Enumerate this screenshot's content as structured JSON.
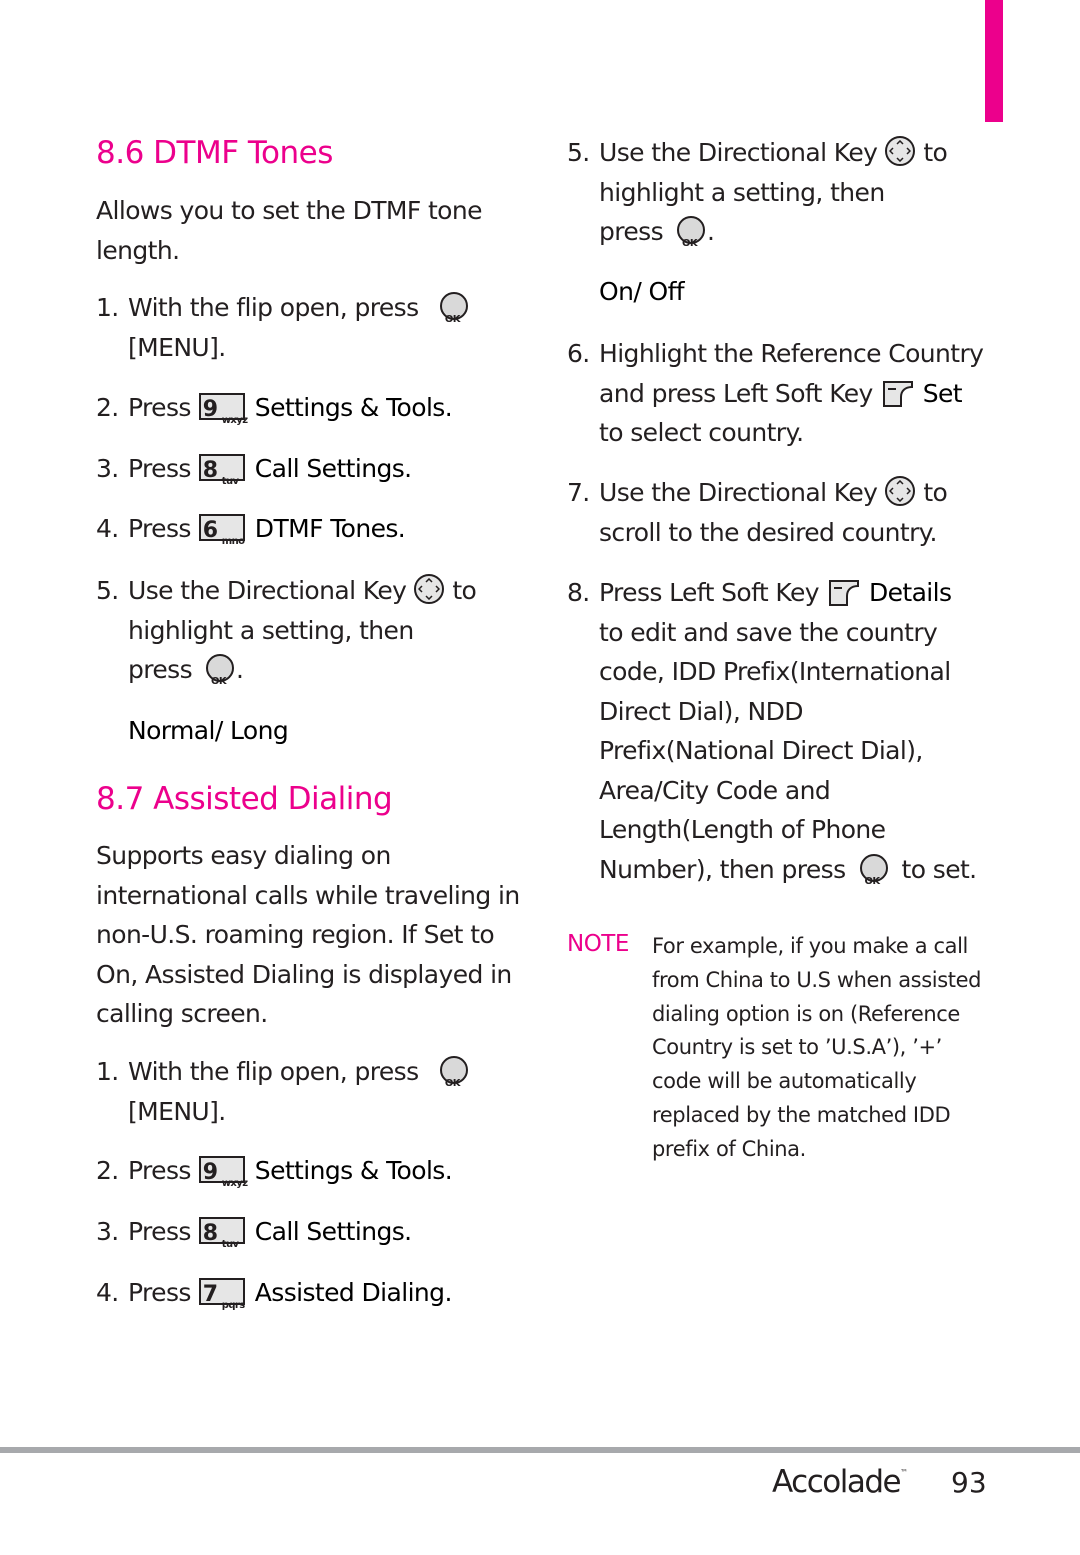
{
  "colors": {
    "accent": "#ec008c",
    "text": "#231f20",
    "rule": "#a7a9ac"
  },
  "dtmf": {
    "title": "8.6 DTMF Tones",
    "intro_1": "Allows you to set the DTMF tone",
    "intro_2": "length.",
    "steps": [
      {
        "num": "1.",
        "text": "With the flip open, press",
        "icon": "ok-key-icon",
        "cont": "[MENU]."
      },
      {
        "num": "2.",
        "text": "Press",
        "key_digit": "9",
        "key_letters": "wxyz",
        "target": "Settings & Tools."
      },
      {
        "num": "3.",
        "text": "Press",
        "key_digit": "8",
        "key_letters": "tuv",
        "target": "Call Settings."
      },
      {
        "num": "4.",
        "text": "Press",
        "key_digit": "6",
        "key_letters": "mno",
        "target": "DTMF Tones."
      },
      {
        "num": "5.",
        "text": "Use the Directional Key",
        "after": "to",
        "line2": "highlight a setting, then",
        "line3": "press",
        "end": "."
      }
    ],
    "options": "Normal/ Long"
  },
  "assisted": {
    "title": "8.7 Assisted Dialing",
    "intro": [
      "Supports easy dialing on",
      "international calls while traveling in",
      "non-U.S. roaming region. If Set to",
      "On, Assisted Dialing is displayed in",
      "calling screen."
    ],
    "steps": [
      {
        "num": "1.",
        "text": "With the flip open, press",
        "cont": "[MENU]."
      },
      {
        "num": "2.",
        "text": "Press",
        "key_digit": "9",
        "key_letters": "wxyz",
        "target": "Settings & Tools."
      },
      {
        "num": "3.",
        "text": "Press",
        "key_digit": "8",
        "key_letters": "tuv",
        "target": "Call Settings."
      },
      {
        "num": "4.",
        "text": "Press",
        "key_digit": "7",
        "key_letters": "pqrs",
        "target": "Assisted Dialing."
      }
    ]
  },
  "right": {
    "step5": {
      "num": "5.",
      "text": "Use the Directional Key",
      "after": "to",
      "line2": "highlight a setting, then",
      "line3": "press",
      "end": "."
    },
    "options": "On/ Off",
    "step6": {
      "num": "6.",
      "line1": "Highlight the Reference Country",
      "line2": "and press Left Soft Key",
      "bold": "Set",
      "line3": "to select country."
    },
    "step7": {
      "num": "7.",
      "text": "Use the Directional Key",
      "after": "to",
      "line2": "scroll to the desired country."
    },
    "step8": {
      "num": "8.",
      "line1": "Press Left Soft Key",
      "bold": "Details",
      "lines": [
        "to edit and save the country",
        "code, IDD Prefix(International",
        "Direct Dial), NDD",
        "Prefix(National Direct Dial),",
        "Area/City Code and",
        "Length(Length of Phone"
      ],
      "last": "Number), then press",
      "last_end": "to set."
    },
    "note": {
      "label": "NOTE",
      "lines": [
        "For example, if you make a call",
        "from China to U.S when assisted",
        "dialing option is on (Reference",
        "Country is set to ’U.S.A’), ’+’",
        "code will be automatically",
        "replaced by the matched IDD",
        "prefix of China."
      ]
    }
  },
  "footer": {
    "brand": "Accolade",
    "tm": "™",
    "page": "93"
  }
}
